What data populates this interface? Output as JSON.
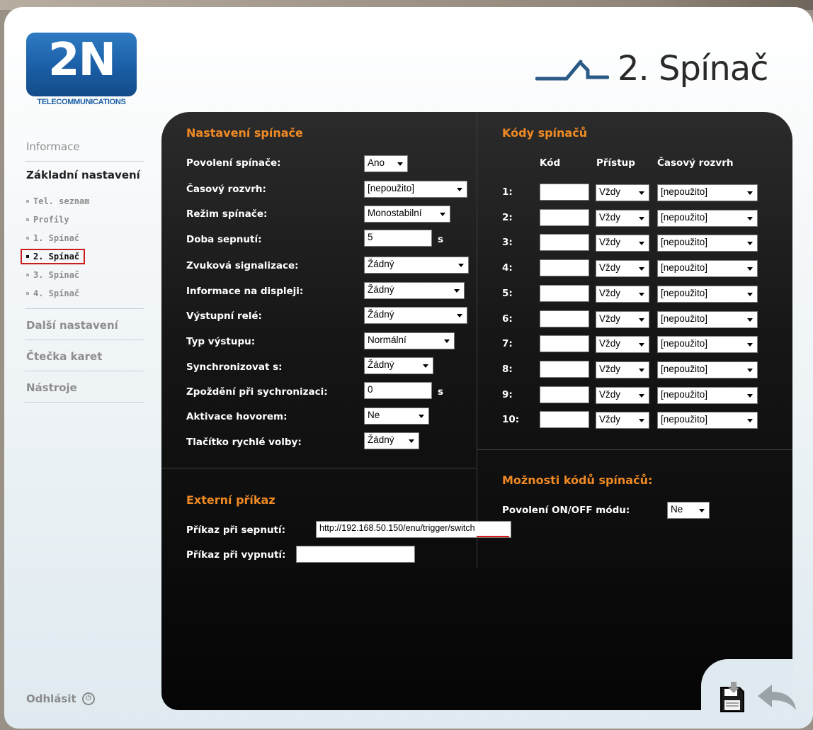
{
  "header": {
    "logo_text": "2N",
    "logo_subtitle": "TELECOMMUNICATIONS",
    "title": "2. Spínač",
    "title_icon": "switch-icon"
  },
  "nav": {
    "items": [
      {
        "label": "Informace"
      },
      {
        "label": "Základní nastavení"
      },
      {
        "label": "Další nastavení"
      },
      {
        "label": "Čtečka karet"
      },
      {
        "label": "Nástroje"
      }
    ],
    "sub_items": [
      {
        "label": "Tel. seznam"
      },
      {
        "label": "Profily"
      },
      {
        "label": "1. Spínač"
      },
      {
        "label": "2. Spínač"
      },
      {
        "label": "3. Spínač"
      },
      {
        "label": "4. Spínač"
      }
    ],
    "logout": "Odhlásit",
    "logout_icon": "power-icon"
  },
  "switch_settings": {
    "title": "Nastavení spínače",
    "rows": [
      {
        "label": "Povolení spínače:",
        "value": "Ano"
      },
      {
        "label": "Časový rozvrh:",
        "value": "[nepoužito]"
      },
      {
        "label": "Režim spínače:",
        "value": "Monostabilní"
      },
      {
        "label": "Doba sepnutí:",
        "value": "5",
        "unit": "s"
      },
      {
        "label": "Zvuková signalizace:",
        "value": "Žádný"
      },
      {
        "label": "Informace na displeji:",
        "value": "Žádný"
      },
      {
        "label": "Výstupní relé:",
        "value": "Žádný"
      },
      {
        "label": "Typ výstupu:",
        "value": "Normální"
      },
      {
        "label": "Synchronizovat s:",
        "value": "Žádný"
      },
      {
        "label": "Zpoždění při sychronizaci:",
        "value": "0",
        "unit": "s"
      },
      {
        "label": "Aktivace hovorem:",
        "value": "Ne"
      },
      {
        "label": "Tlačítko rychlé volby:",
        "value": "Žádný"
      }
    ]
  },
  "switch_codes": {
    "title": "Kódy spínačů",
    "headers": {
      "code": "Kód",
      "access": "Přístup",
      "schedule": "Časový rozvrh"
    },
    "rows": [
      {
        "num": "1:",
        "code": "",
        "access": "Vždy",
        "schedule": "[nepoužito]"
      },
      {
        "num": "2:",
        "code": "",
        "access": "Vždy",
        "schedule": "[nepoužito]"
      },
      {
        "num": "3:",
        "code": "",
        "access": "Vždy",
        "schedule": "[nepoužito]"
      },
      {
        "num": "4:",
        "code": "",
        "access": "Vždy",
        "schedule": "[nepoužito]"
      },
      {
        "num": "5:",
        "code": "",
        "access": "Vždy",
        "schedule": "[nepoužito]"
      },
      {
        "num": "6:",
        "code": "",
        "access": "Vždy",
        "schedule": "[nepoužito]"
      },
      {
        "num": "7:",
        "code": "",
        "access": "Vždy",
        "schedule": "[nepoužito]"
      },
      {
        "num": "8:",
        "code": "",
        "access": "Vždy",
        "schedule": "[nepoužito]"
      },
      {
        "num": "9:",
        "code": "",
        "access": "Vždy",
        "schedule": "[nepoužito]"
      },
      {
        "num": "10:",
        "code": "",
        "access": "Vždy",
        "schedule": "[nepoužito]"
      }
    ]
  },
  "external_command": {
    "title": "Externí příkaz",
    "on_label": "Příkaz při sepnutí:",
    "on_value": "http://192.168.50.150/enu/trigger/switch",
    "off_label": "Příkaz při vypnutí:",
    "off_value": ""
  },
  "code_options": {
    "title": "Možnosti kódů spínačů:",
    "onoff_label": "Povolení ON/OFF módu:",
    "onoff_value": "Ne"
  },
  "footer": {
    "save_icon": "save-icon",
    "back_icon": "back-arrow-icon"
  },
  "colors": {
    "accent": "#f08a24",
    "highlight": "#cc1c1c",
    "brand": "#1a5ea6"
  }
}
